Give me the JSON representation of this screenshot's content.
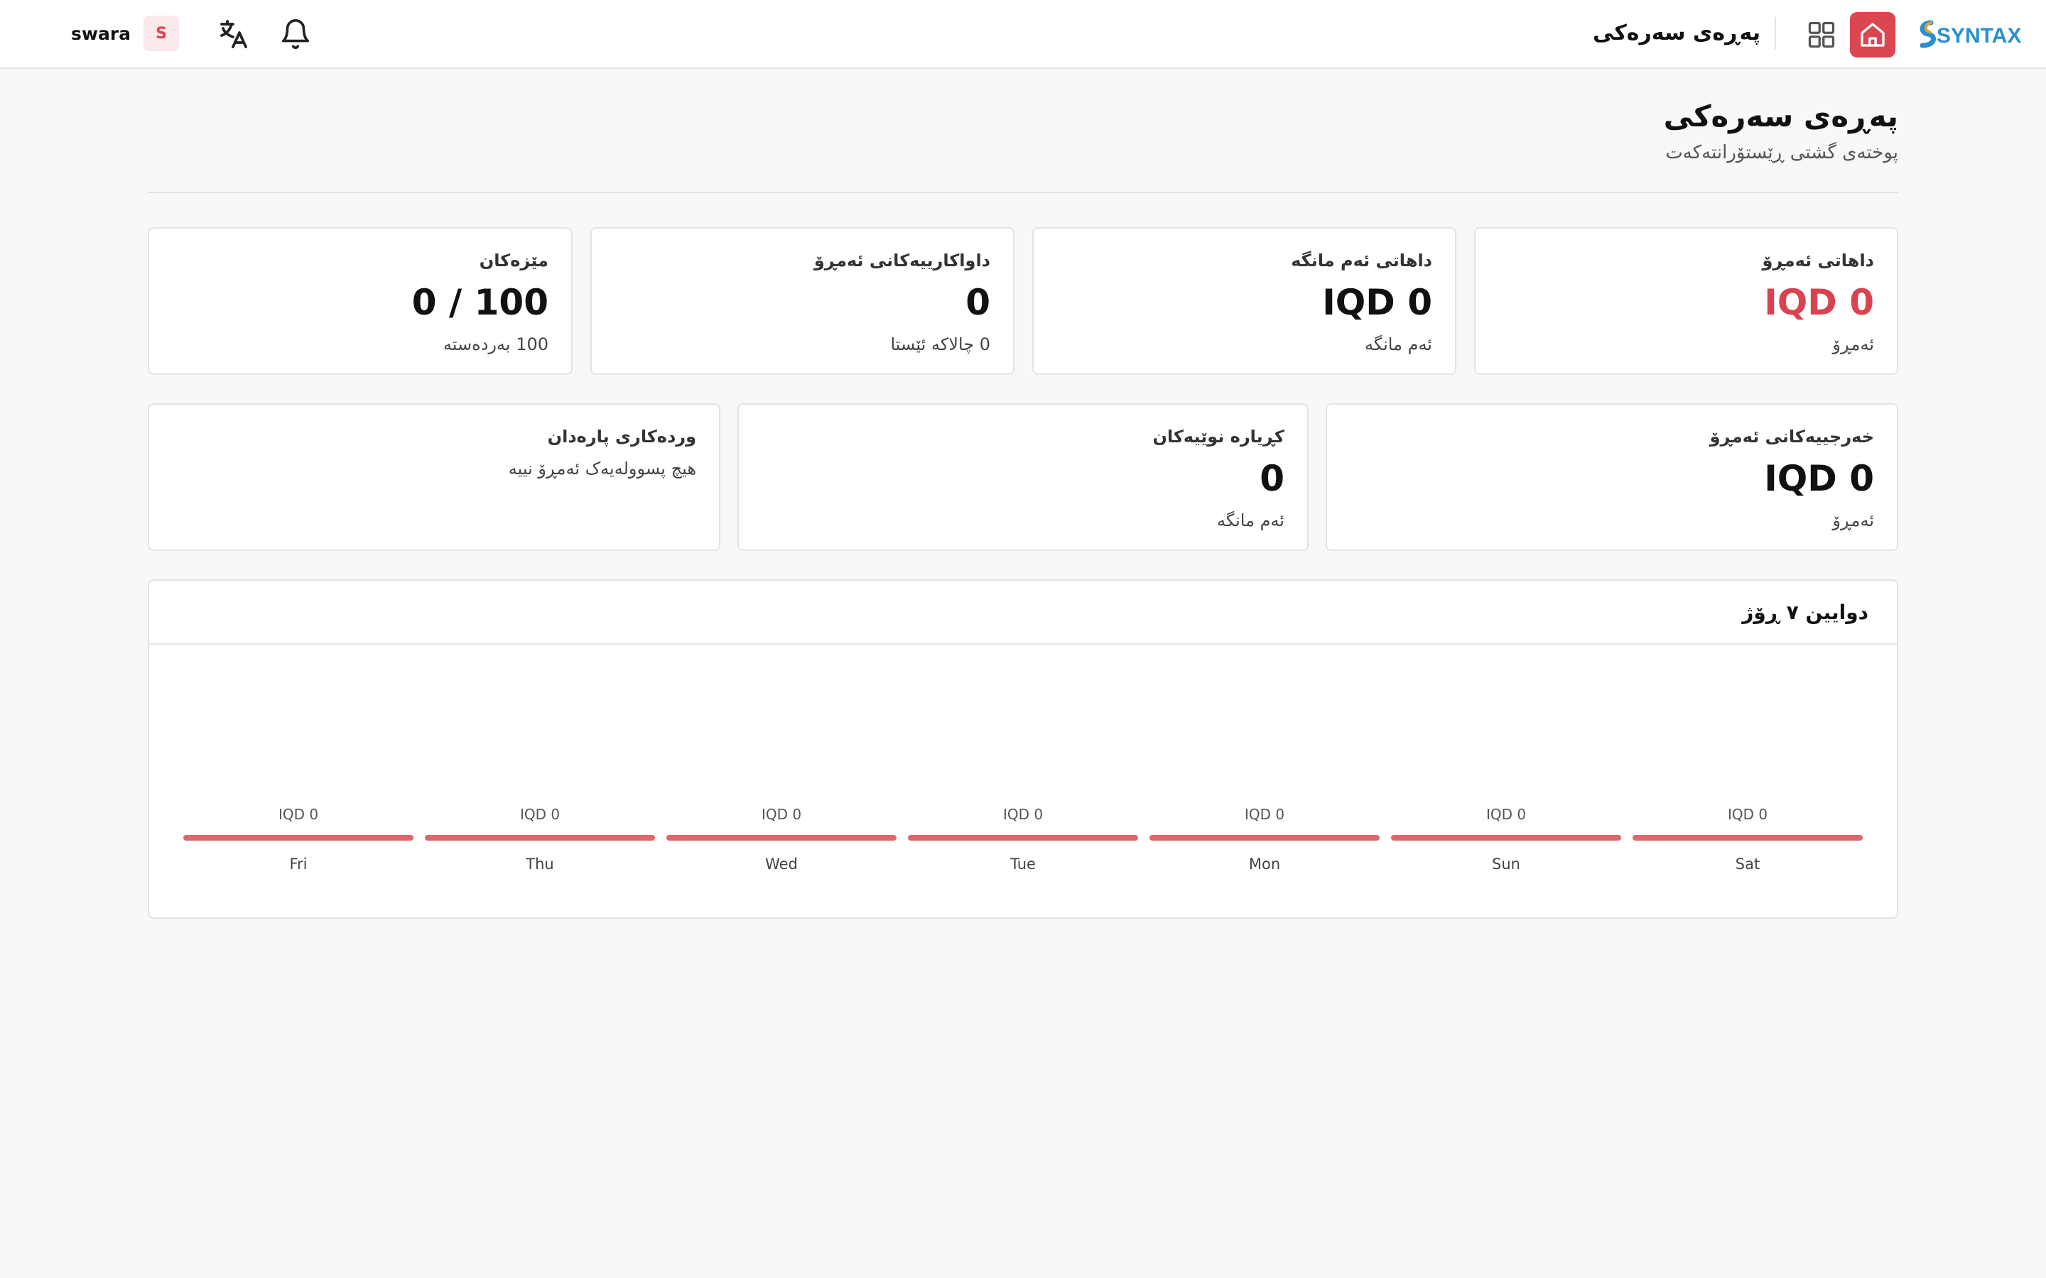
{
  "topbar": {
    "user_name": "swara",
    "avatar_letter": "S",
    "title": "پەڕەی سەرەکی",
    "logo_text": "SYNTAX",
    "accent": "#dc4650"
  },
  "page": {
    "title": "پەڕەی سەرەکی",
    "subtitle": "پوختەی گشتی ڕێستۆرانتەکەت"
  },
  "cards": {
    "revenue_today": {
      "label": "داهاتی ئەمڕۆ",
      "value": "IQD 0",
      "sub": "ئەمڕۆ"
    },
    "revenue_month": {
      "label": "داهاتی ئەم مانگە",
      "value": "IQD 0",
      "sub": "ئەم مانگە"
    },
    "orders_today": {
      "label": "داواکارییەکانی ئەمڕۆ",
      "value": "0",
      "sub": "0 چالاکە ئێستا"
    },
    "tables": {
      "label": "مێزەکان",
      "value": "100 / 0",
      "sub": "100 بەردەستە"
    },
    "expenses_today": {
      "label": "خەرجییەکانی ئەمڕۆ",
      "value": "IQD 0",
      "sub": "ئەمڕۆ"
    },
    "new_customers": {
      "label": "کڕیارە نوێیەکان",
      "value": "0",
      "sub": "ئەم مانگە"
    },
    "payment_details": {
      "label": "وردەکاری پارەدان",
      "text": "هیچ پسوولەیەک ئەمڕۆ نییە"
    }
  },
  "chart_data": {
    "type": "bar",
    "title": "دوایین ٧ ڕۆژ",
    "categories": [
      "Fri",
      "Thu",
      "Wed",
      "Tue",
      "Mon",
      "Sun",
      "Sat"
    ],
    "values": [
      0,
      0,
      0,
      0,
      0,
      0,
      0
    ],
    "value_labels": [
      "IQD 0",
      "IQD 0",
      "IQD 0",
      "IQD 0",
      "IQD 0",
      "IQD 0",
      "IQD 0"
    ],
    "bar_color": "#e0656d",
    "grid": false
  }
}
